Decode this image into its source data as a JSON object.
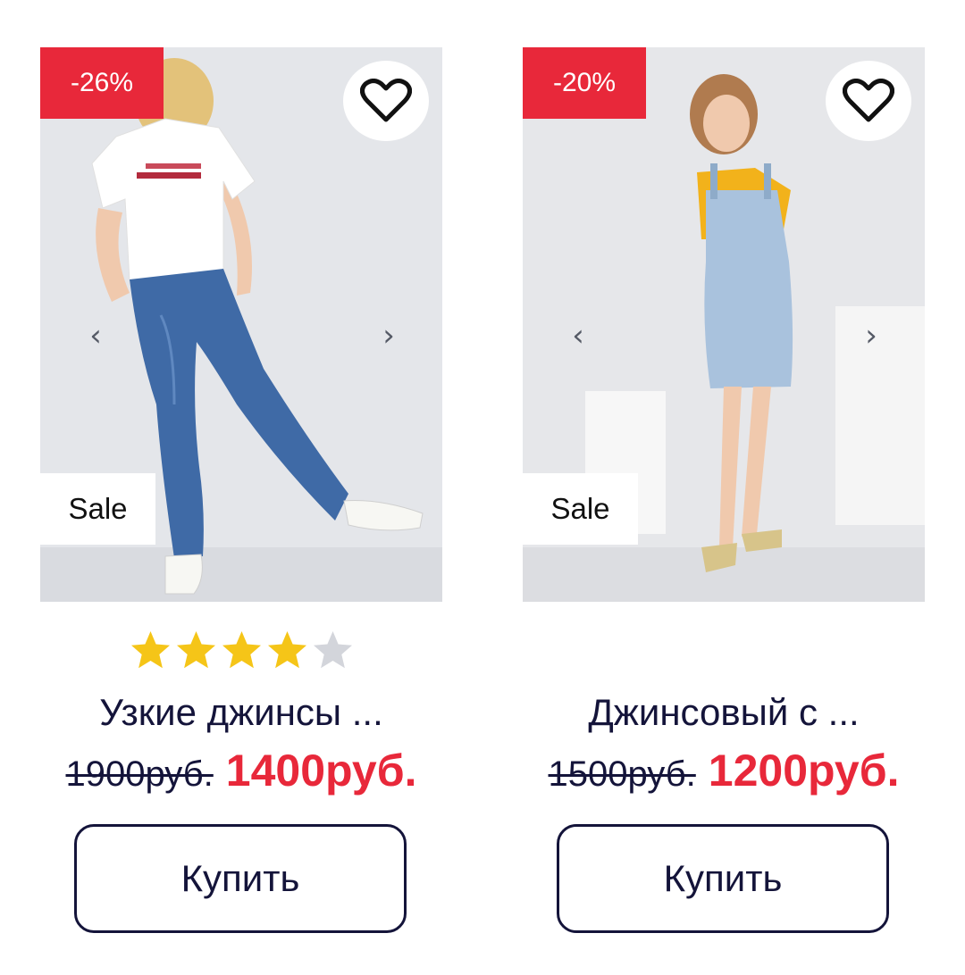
{
  "products": [
    {
      "discount": "-26%",
      "sale_label": "Sale",
      "prev_arrow": "‹",
      "next_arrow": "›",
      "favorite_icon": "heart-outline-icon",
      "rating": 4,
      "rating_max": 5,
      "title": "Узкие джинсы ...",
      "old_price": "1900руб.",
      "new_price": "1400руб.",
      "buy_label": "Купить"
    },
    {
      "discount": "-20%",
      "sale_label": "Sale",
      "prev_arrow": "‹",
      "next_arrow": "›",
      "favorite_icon": "heart-outline-icon",
      "rating": null,
      "rating_max": 5,
      "title": "Джинсовый с ...",
      "old_price": "1500руб.",
      "new_price": "1200руб.",
      "buy_label": "Купить"
    }
  ],
  "colors": {
    "discount_badge": "#e8283a",
    "sale_price": "#e8283a",
    "text": "#14143a",
    "star_filled": "#f5c518",
    "star_empty": "#d3d5db"
  }
}
